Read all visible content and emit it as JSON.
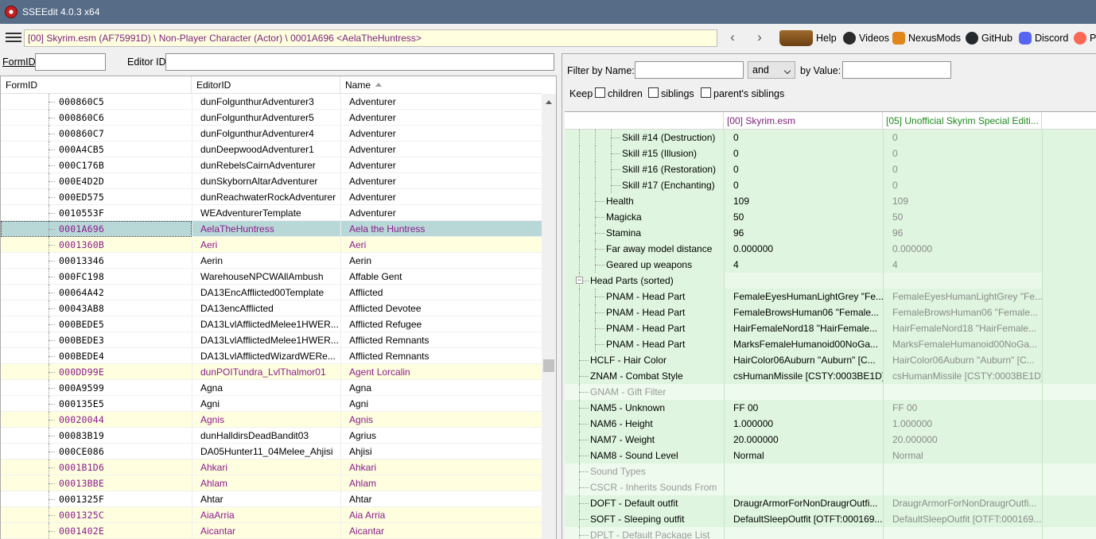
{
  "window": {
    "title": "SSEEdit 4.0.3 x64"
  },
  "toolbar": {
    "path": "[00] Skyrim.esm (AF75991D) \\ Non-Player Character (Actor) \\ 0001A696 <AelaTheHuntress>",
    "back": "‹",
    "forward": "›",
    "links": [
      {
        "label": "Help",
        "icon": "book-icon"
      },
      {
        "label": "Videos",
        "icon": "videos-icon"
      },
      {
        "label": "NexusMods",
        "icon": "nexusmods-icon"
      },
      {
        "label": "GitHub",
        "icon": "github-icon"
      },
      {
        "label": "Discord",
        "icon": "discord-icon"
      },
      {
        "label": "P",
        "icon": "patreon-icon"
      }
    ]
  },
  "left_filter": {
    "formid_label": "FormID",
    "editorid_label": "Editor ID",
    "formid_value": "",
    "editorid_value": ""
  },
  "left_table": {
    "columns": [
      "FormID",
      "EditorID",
      "Name"
    ],
    "rows": [
      {
        "formid": "000860C5",
        "editorid": "dunFolgunthurAdventurer3",
        "name": "Adventurer",
        "state": "normal"
      },
      {
        "formid": "000860C6",
        "editorid": "dunFolgunthurAdventurer5",
        "name": "Adventurer",
        "state": "normal"
      },
      {
        "formid": "000860C7",
        "editorid": "dunFolgunthurAdventurer4",
        "name": "Adventurer",
        "state": "normal"
      },
      {
        "formid": "000A4CB5",
        "editorid": "dunDeepwoodAdventurer1",
        "name": "Adventurer",
        "state": "normal"
      },
      {
        "formid": "000C176B",
        "editorid": "dunRebelsCairnAdventurer",
        "name": "Adventurer",
        "state": "normal"
      },
      {
        "formid": "000E4D2D",
        "editorid": "dunSkybornAltarAdventurer",
        "name": "Adventurer",
        "state": "normal"
      },
      {
        "formid": "000ED575",
        "editorid": "dunReachwaterRockAdventurer",
        "name": "Adventurer",
        "state": "normal"
      },
      {
        "formid": "0010553F",
        "editorid": "WEAdventurerTemplate",
        "name": "Adventurer",
        "state": "normal"
      },
      {
        "formid": "0001A696",
        "editorid": "AelaTheHuntress",
        "name": "Aela the Huntress",
        "state": "selected"
      },
      {
        "formid": "0001360B",
        "editorid": "Aeri",
        "name": "Aeri",
        "state": "override"
      },
      {
        "formid": "00013346",
        "editorid": "Aerin",
        "name": "Aerin",
        "state": "normal"
      },
      {
        "formid": "000FC198",
        "editorid": "WarehouseNPCWAllAmbush",
        "name": "Affable Gent",
        "state": "normal"
      },
      {
        "formid": "00064A42",
        "editorid": "DA13EncAfflicted00Template",
        "name": "Afflicted",
        "state": "normal"
      },
      {
        "formid": "00043AB8",
        "editorid": "DA13encAfflicted",
        "name": "Afflicted Devotee",
        "state": "normal"
      },
      {
        "formid": "000BEDE5",
        "editorid": "DA13LvlAfflictedMelee1HWER...",
        "name": "Afflicted Refugee",
        "state": "normal"
      },
      {
        "formid": "000BEDE3",
        "editorid": "DA13LvlAfflictedMelee1HWER...",
        "name": "Afflicted Remnants",
        "state": "normal"
      },
      {
        "formid": "000BEDE4",
        "editorid": "DA13LvlAfflictedWizardWERe...",
        "name": "Afflicted Remnants",
        "state": "normal"
      },
      {
        "formid": "000DD99E",
        "editorid": "dunPOITundra_LvlThalmor01",
        "name": "Agent Lorcalin",
        "state": "override"
      },
      {
        "formid": "000A9599",
        "editorid": "Agna",
        "name": "Agna",
        "state": "normal"
      },
      {
        "formid": "000135E5",
        "editorid": "Agni",
        "name": "Agni",
        "state": "normal"
      },
      {
        "formid": "00020044",
        "editorid": "Agnis",
        "name": "Agnis",
        "state": "override"
      },
      {
        "formid": "00083B19",
        "editorid": "dunHalldirsDeadBandit03",
        "name": "Agrius",
        "state": "normal"
      },
      {
        "formid": "000CE086",
        "editorid": "DA05Hunter11_04Melee_Ahjisi",
        "name": "Ahjisi",
        "state": "normal"
      },
      {
        "formid": "0001B1D6",
        "editorid": "Ahkari",
        "name": "Ahkari",
        "state": "override"
      },
      {
        "formid": "00013BBE",
        "editorid": "Ahlam",
        "name": "Ahlam",
        "state": "override"
      },
      {
        "formid": "0001325F",
        "editorid": "Ahtar",
        "name": "Ahtar",
        "state": "normal"
      },
      {
        "formid": "0001325C",
        "editorid": "AiaArria",
        "name": "Aia Arria",
        "state": "override"
      },
      {
        "formid": "0001402E",
        "editorid": "Aicantar",
        "name": "Aicantar",
        "state": "override"
      }
    ]
  },
  "right_filter": {
    "filter_by_name_label": "Filter by Name:",
    "filter_name_value": "",
    "and_select": "and",
    "by_value_label": "by Value:",
    "filter_value_value": "",
    "keep_label": "Keep",
    "children_label": "children",
    "siblings_label": "siblings",
    "parents_siblings_label": "parent's siblings"
  },
  "record_grid": {
    "columns": [
      "",
      "[00] Skyrim.esm",
      "[05] Unofficial Skyrim Special Editi..."
    ],
    "rows": [
      {
        "label": "Skill #14 (Destruction)",
        "indent": 3,
        "v1": "0",
        "v2": "0",
        "style": "normal"
      },
      {
        "label": "Skill #15 (Illusion)",
        "indent": 3,
        "v1": "0",
        "v2": "0",
        "style": "normal"
      },
      {
        "label": "Skill #16 (Restoration)",
        "indent": 3,
        "v1": "0",
        "v2": "0",
        "style": "normal"
      },
      {
        "label": "Skill #17 (Enchanting)",
        "indent": 3,
        "v1": "0",
        "v2": "0",
        "style": "normal"
      },
      {
        "label": "Health",
        "indent": 2,
        "v1": "109",
        "v2": "109",
        "style": "normal"
      },
      {
        "label": "Magicka",
        "indent": 2,
        "v1": "50",
        "v2": "50",
        "style": "normal"
      },
      {
        "label": "Stamina",
        "indent": 2,
        "v1": "96",
        "v2": "96",
        "style": "normal"
      },
      {
        "label": "Far away model distance",
        "indent": 2,
        "v1": "0.000000",
        "v2": "0.000000",
        "style": "normal"
      },
      {
        "label": "Geared up weapons",
        "indent": 2,
        "v1": "4",
        "v2": "4",
        "style": "normal"
      },
      {
        "label": "Head Parts (sorted)",
        "indent": 1,
        "v1": "",
        "v2": "",
        "style": "head"
      },
      {
        "label": "PNAM - Head Part",
        "indent": 2,
        "v1": "FemaleEyesHumanLightGrey \"Fe...",
        "v2": "FemaleEyesHumanLightGrey \"Fe...",
        "style": "normal"
      },
      {
        "label": "PNAM - Head Part",
        "indent": 2,
        "v1": "FemaleBrowsHuman06 \"Female...",
        "v2": "FemaleBrowsHuman06 \"Female...",
        "style": "normal"
      },
      {
        "label": "PNAM - Head Part",
        "indent": 2,
        "v1": "HairFemaleNord18 \"HairFemale...",
        "v2": "HairFemaleNord18 \"HairFemale...",
        "style": "normal"
      },
      {
        "label": "PNAM - Head Part",
        "indent": 2,
        "v1": "MarksFemaleHumanoid00NoGa...",
        "v2": "MarksFemaleHumanoid00NoGa...",
        "style": "normal"
      },
      {
        "label": "HCLF - Hair Color",
        "indent": 1,
        "v1": "HairColor06Auburn \"Auburn\" [C...",
        "v2": "HairColor06Auburn \"Auburn\" [C...",
        "style": "normal"
      },
      {
        "label": "ZNAM - Combat Style",
        "indent": 1,
        "v1": "csHumanMissile [CSTY:0003BE1D]",
        "v2": "csHumanMissile [CSTY:0003BE1D]",
        "style": "normal"
      },
      {
        "label": "GNAM - Gift Filter",
        "indent": 1,
        "v1": "",
        "v2": "",
        "style": "dim"
      },
      {
        "label": "NAM5 - Unknown",
        "indent": 1,
        "v1": "FF 00",
        "v2": "FF 00",
        "style": "normal"
      },
      {
        "label": "NAM6 - Height",
        "indent": 1,
        "v1": "1.000000",
        "v2": "1.000000",
        "style": "normal"
      },
      {
        "label": "NAM7 - Weight",
        "indent": 1,
        "v1": "20.000000",
        "v2": "20.000000",
        "style": "normal"
      },
      {
        "label": "NAM8 - Sound Level",
        "indent": 1,
        "v1": "Normal",
        "v2": "Normal",
        "style": "normal"
      },
      {
        "label": "Sound Types",
        "indent": 1,
        "v1": "",
        "v2": "",
        "style": "dim"
      },
      {
        "label": "CSCR - Inherits Sounds From",
        "indent": 1,
        "v1": "",
        "v2": "",
        "style": "dim"
      },
      {
        "label": "DOFT - Default outfit",
        "indent": 1,
        "v1": "DraugrArmorForNonDraugrOutfi...",
        "v2": "DraugrArmorForNonDraugrOutfi...",
        "style": "normal"
      },
      {
        "label": "SOFT - Sleeping outfit",
        "indent": 1,
        "v1": "DefaultSleepOutfit [OTFT:000169...",
        "v2": "DefaultSleepOutfit [OTFT:000169...",
        "style": "normal"
      },
      {
        "label": "DPLT - Default Package List",
        "indent": 1,
        "v1": "",
        "v2": "",
        "style": "dim"
      }
    ]
  },
  "colors": {
    "titlebar": "#566c87",
    "override_bg": "#ffffe0",
    "override_text": "#8b1a8b",
    "selected_bg": "#b8d8d8",
    "grid_green": "#dff5df",
    "usse_header": "#1a8a1a"
  }
}
